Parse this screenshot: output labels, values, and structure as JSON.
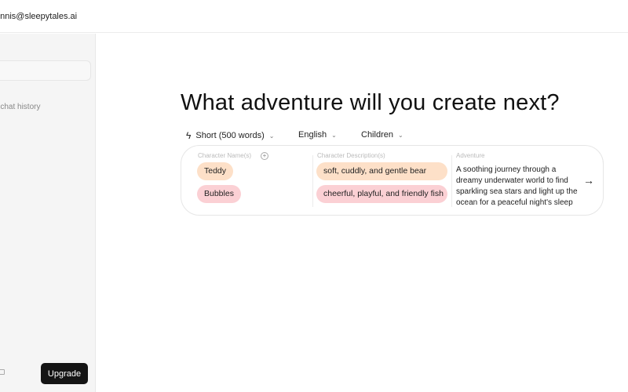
{
  "header": {
    "email": "ennis@sleepytales.ai"
  },
  "sidebar": {
    "history_text": "o chat history",
    "upgrade_label": "Upgrade"
  },
  "main": {
    "title": "What adventure will you create next?",
    "options": {
      "length": "Short (500 words)",
      "language": "English",
      "audience": "Children"
    },
    "card": {
      "names_label": "Character Name(s)",
      "desc_label": "Character Description(s)",
      "adventure_label": "Adventure",
      "characters": [
        {
          "name": "Teddy",
          "description": "soft, cuddly, and gentle bear",
          "color": "#fde0c8"
        },
        {
          "name": "Bubbles",
          "description": "cheerful, playful, and friendly fish",
          "color": "#fbd0d4"
        }
      ],
      "adventure": "A soothing journey through a dreamy underwater world to find sparkling sea stars and light up the ocean for a peaceful night's sleep"
    }
  }
}
